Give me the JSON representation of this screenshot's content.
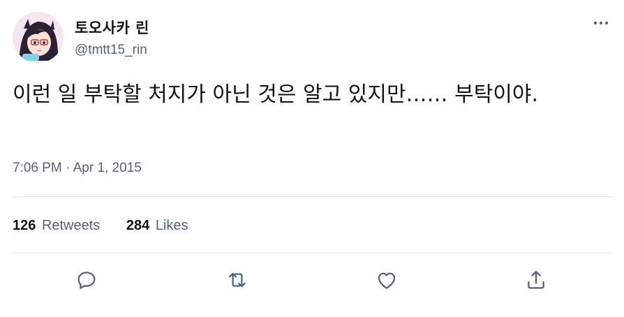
{
  "author": {
    "display_name": "토오사카 린",
    "handle": "@tmtt15_rin",
    "avatar_icon": "avatar-image"
  },
  "tweet": {
    "text": "이런 일 부탁할 처지가 아닌 것은 알고 있지만…… 부탁이야.",
    "time": "7:06 PM",
    "separator": "·",
    "date": "Apr 1, 2015"
  },
  "stats": {
    "retweets_count": "126",
    "retweets_label": "Retweets",
    "likes_count": "284",
    "likes_label": "Likes"
  },
  "actions": {
    "reply_icon": "reply-icon",
    "retweet_icon": "retweet-icon",
    "like_icon": "heart-icon",
    "share_icon": "share-icon"
  },
  "colors": {
    "text_primary": "#0f1419",
    "text_secondary": "#536471",
    "divider": "#e1e8ed"
  }
}
